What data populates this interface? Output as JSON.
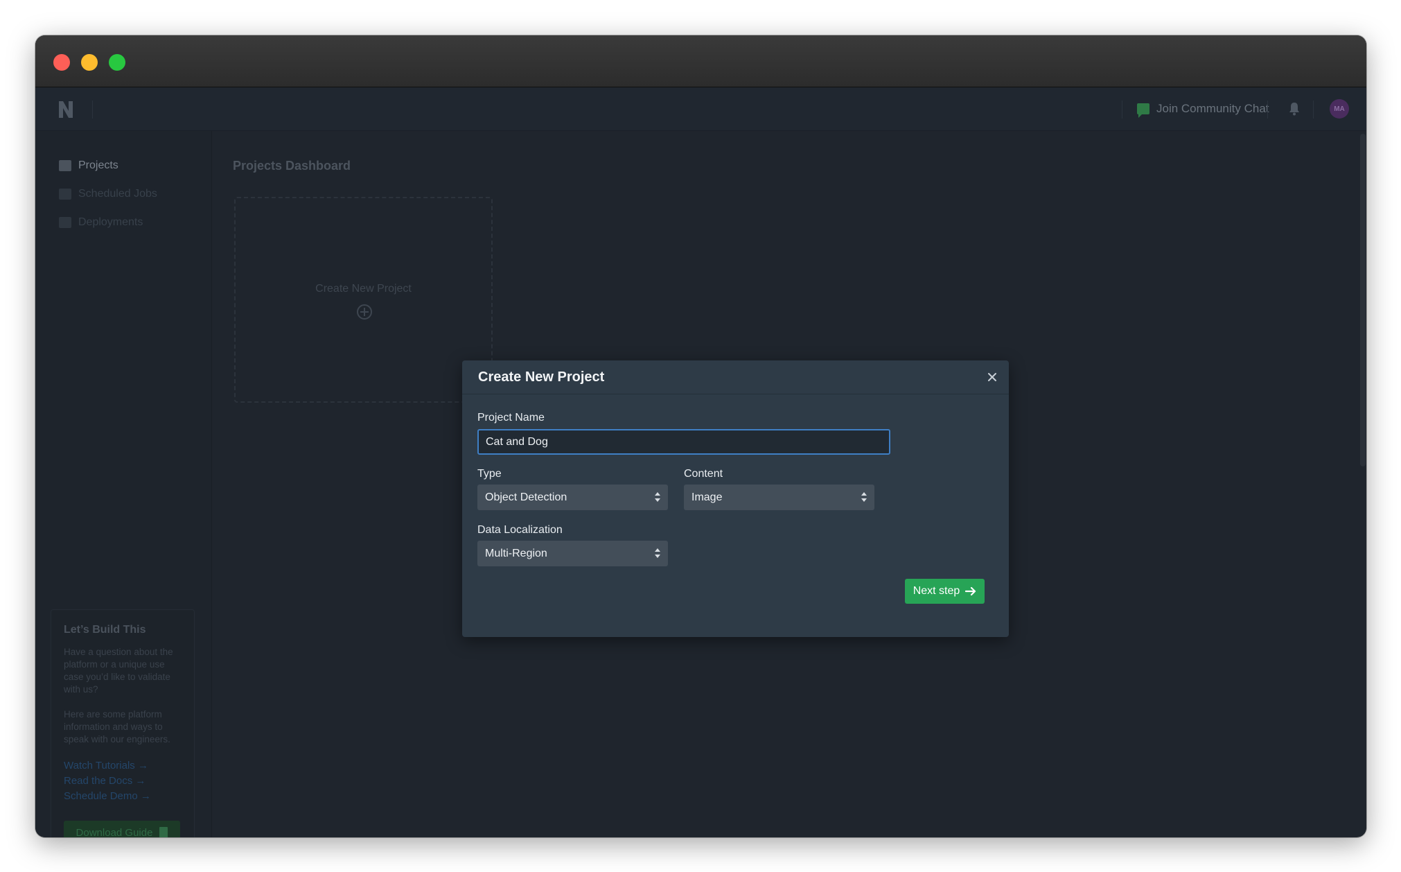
{
  "topnav": {
    "community_label": "Join Community Chat",
    "avatar_initials": "MA"
  },
  "sidebar": {
    "items": [
      {
        "label": "Projects",
        "icon": "folder-icon"
      },
      {
        "label": "Scheduled Jobs",
        "icon": "camera-icon"
      },
      {
        "label": "Deployments",
        "icon": "cloud-upload-icon"
      }
    ],
    "promo": {
      "title": "Let’s Build This",
      "text1": "Have a question about the platform or a unique use case you’d like to validate with us?",
      "text2": "Here are some platform information and ways to speak with our engineers.",
      "links": [
        "Watch Tutorials →",
        "Read the Docs →",
        "Schedule Demo →"
      ],
      "download_label": "Download Guide"
    }
  },
  "dashboard": {
    "title": "Projects Dashboard",
    "new_card_label": "Create New Project"
  },
  "modal": {
    "title": "Create New Project",
    "project_name_label": "Project Name",
    "project_name_value": "Cat and Dog",
    "type_label": "Type",
    "type_value": "Object Detection",
    "content_label": "Content",
    "content_value": "Image",
    "localization_label": "Data Localization",
    "localization_value": "Multi-Region",
    "next_label": "Next step"
  },
  "colors": {
    "accent_green": "#27a456",
    "focus_blue": "#3f7fc5",
    "modal_bg": "#2e3b47"
  }
}
